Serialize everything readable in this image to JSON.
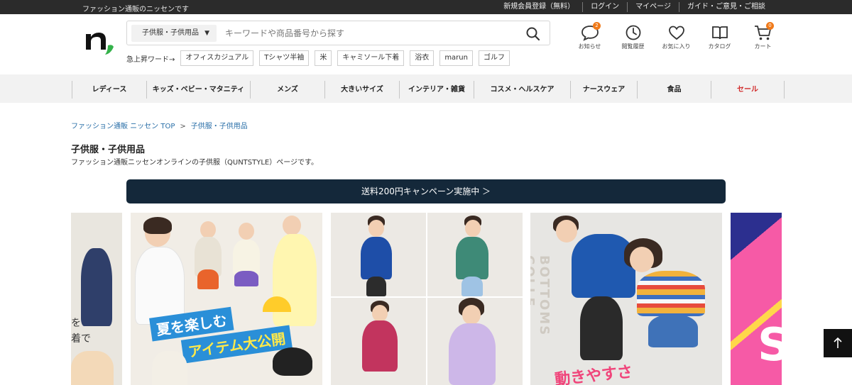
{
  "topbar": {
    "tagline": "ファッション通販のニッセンです",
    "links": [
      "新規会員登録（無料）",
      "ログイン",
      "マイページ",
      "ガイド・ご意見・ご相談"
    ]
  },
  "header": {
    "search": {
      "category": "子供服・子供用品",
      "placeholder": "キーワードや商品番号から探す"
    },
    "hot_words": {
      "label": "急上昇ワード→",
      "tags": [
        "オフィスカジュアル",
        "Tシャツ半袖",
        "米",
        "キャミソール下着",
        "浴衣",
        "marun",
        "ゴルフ"
      ]
    },
    "icons": [
      {
        "label": "お知らせ",
        "icon": "notification-bubble-icon",
        "badge": "2"
      },
      {
        "label": "閲覧履歴",
        "icon": "clock-icon",
        "badge": ""
      },
      {
        "label": "お気に入り",
        "icon": "heart-icon",
        "badge": ""
      },
      {
        "label": "カタログ",
        "icon": "book-icon",
        "badge": ""
      },
      {
        "label": "カート",
        "icon": "cart-icon",
        "badge": "0"
      }
    ],
    "accent_color": "#f07a1a"
  },
  "nav": {
    "items": [
      "レディース",
      "キッズ・ベビー・マタニティ",
      "メンズ",
      "大きいサイズ",
      "インテリア・雑貨",
      "コスメ・ヘルスケア",
      "ナースウェア",
      "食品",
      "セール"
    ],
    "sale_color": "#d12a2a"
  },
  "breadcrumb": {
    "home": "ファッション通販 ニッセン TOP",
    "separator": ">",
    "current": "子供服・子供用品"
  },
  "page": {
    "title": "子供服・子供用品",
    "description": "ファッション通販ニッセンオンラインの子供服（QUNTSTYLE）ページです。"
  },
  "campaign": {
    "label": "送料200円キャンペーン実施中 ＞",
    "color": "#14283a"
  },
  "banners": {
    "prev_fragment": "を\n着で",
    "summer_line1": "夏を楽しむ",
    "summer_line2": "アイテム大公開",
    "bottoms_vertical": "BOTTOMS COLLE",
    "move_text": "動きやすさ",
    "next_fragment": "S"
  }
}
